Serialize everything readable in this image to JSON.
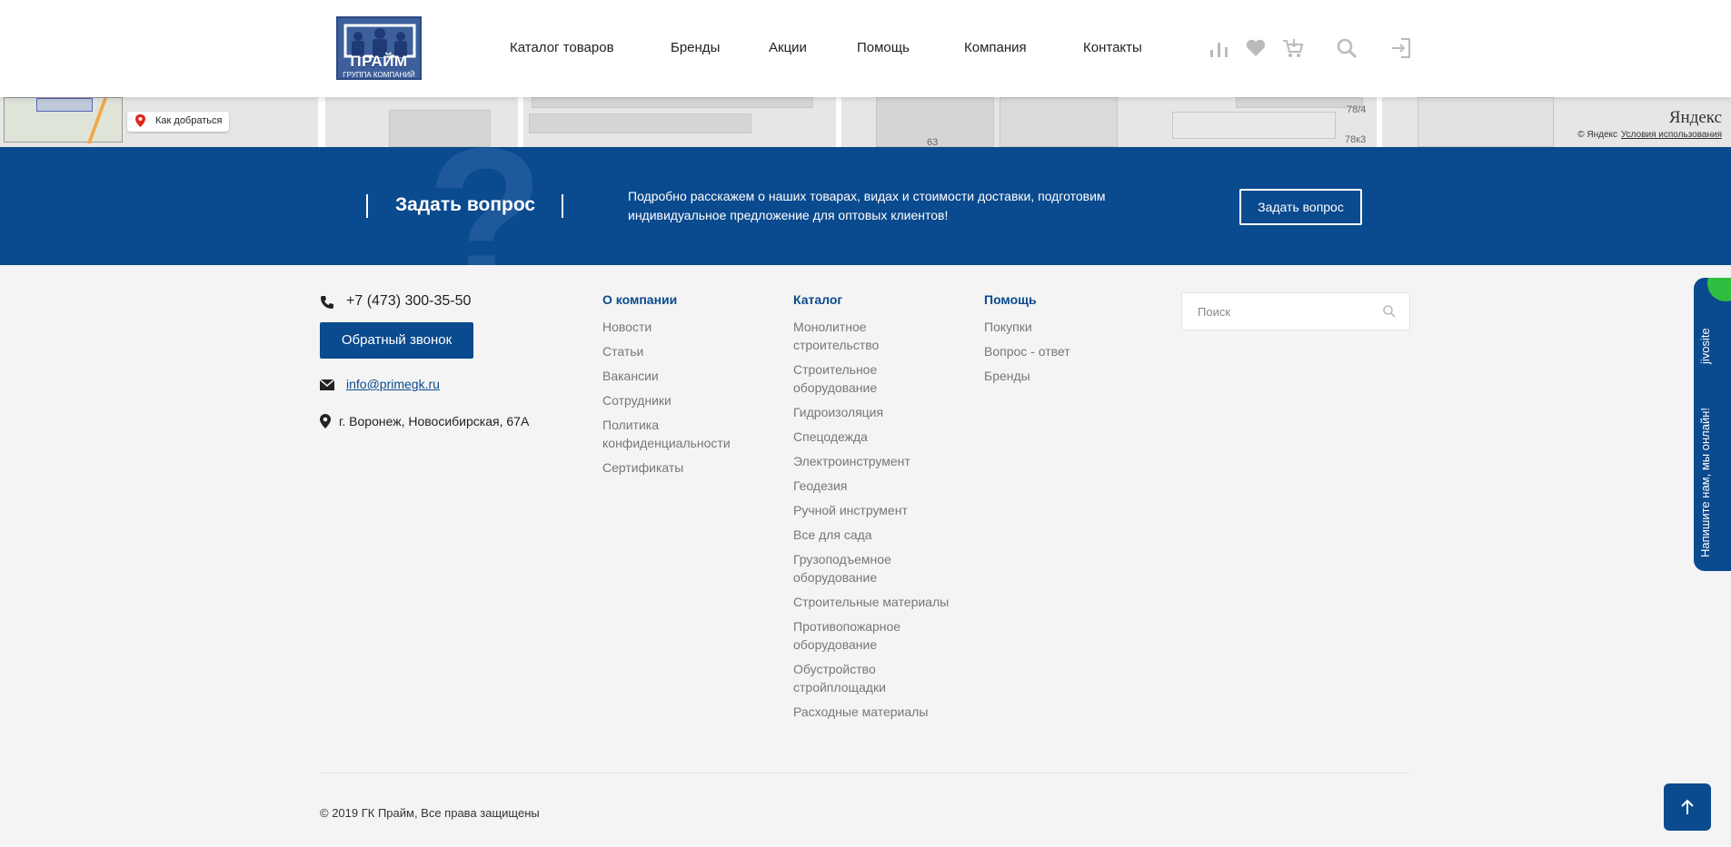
{
  "header": {
    "logo": {
      "brand": "ПРАЙМ",
      "subtitle": "ГРУППА КОМПАНИЙ"
    },
    "nav": [
      {
        "label": "Каталог товаров"
      },
      {
        "label": "Бренды"
      },
      {
        "label": "Акции"
      },
      {
        "label": "Помощь"
      },
      {
        "label": "Компания"
      },
      {
        "label": "Контакты"
      }
    ],
    "icons": [
      "compare-icon",
      "heart-icon",
      "cart-icon",
      "search-icon",
      "login-icon"
    ]
  },
  "map": {
    "route_label": "Как добраться",
    "labels": [
      "78/4",
      "78к3",
      "63"
    ],
    "yandex_logo": "Яндекс",
    "copyright": "© Яндекс",
    "terms": "Условия использования"
  },
  "ask": {
    "title": "Задать вопрос",
    "description": "Подробно расскажем о наших товарах, видах и стоимости доставки, подготовим индивидуальное предложение для оптовых клиентов!",
    "button": "Задать вопрос"
  },
  "footer": {
    "phone": "+7 (473) 300-35-50",
    "callback": "Обратный звонок",
    "email": "info@primegk.ru",
    "address": "г. Воронеж, Новосибирская, 67А",
    "columns": [
      {
        "title": "О компании",
        "items": [
          "Новости",
          "Статьи",
          "Вакансии",
          "Сотрудники",
          "Политика конфиденциальности",
          "Сертификаты"
        ]
      },
      {
        "title": "Каталог",
        "items": [
          "Монолитное строительство",
          "Строительное оборудование",
          "Гидроизоляция",
          "Спецодежда",
          "Электроинструмент",
          "Геодезия",
          "Ручной инструмент",
          "Все для сада",
          "Грузоподъемное оборудование",
          "Строительные материалы",
          "Противопожарное оборудование",
          "Обустройство стройплощадки",
          "Расходные материалы"
        ]
      },
      {
        "title": "Помощь",
        "items": [
          "Покупки",
          "Вопрос - ответ",
          "Бренды"
        ]
      }
    ],
    "search_placeholder": "Поиск",
    "copyright": "© 2019 ГК Прайм, Все права защищены"
  },
  "jivo": {
    "brand": "jivosite",
    "text": "Напишите нам, мы онлайн!"
  },
  "colors": {
    "primary": "#0a4a8e",
    "jivo_green": "#2fbe3f",
    "background": "#f4f4f4"
  }
}
